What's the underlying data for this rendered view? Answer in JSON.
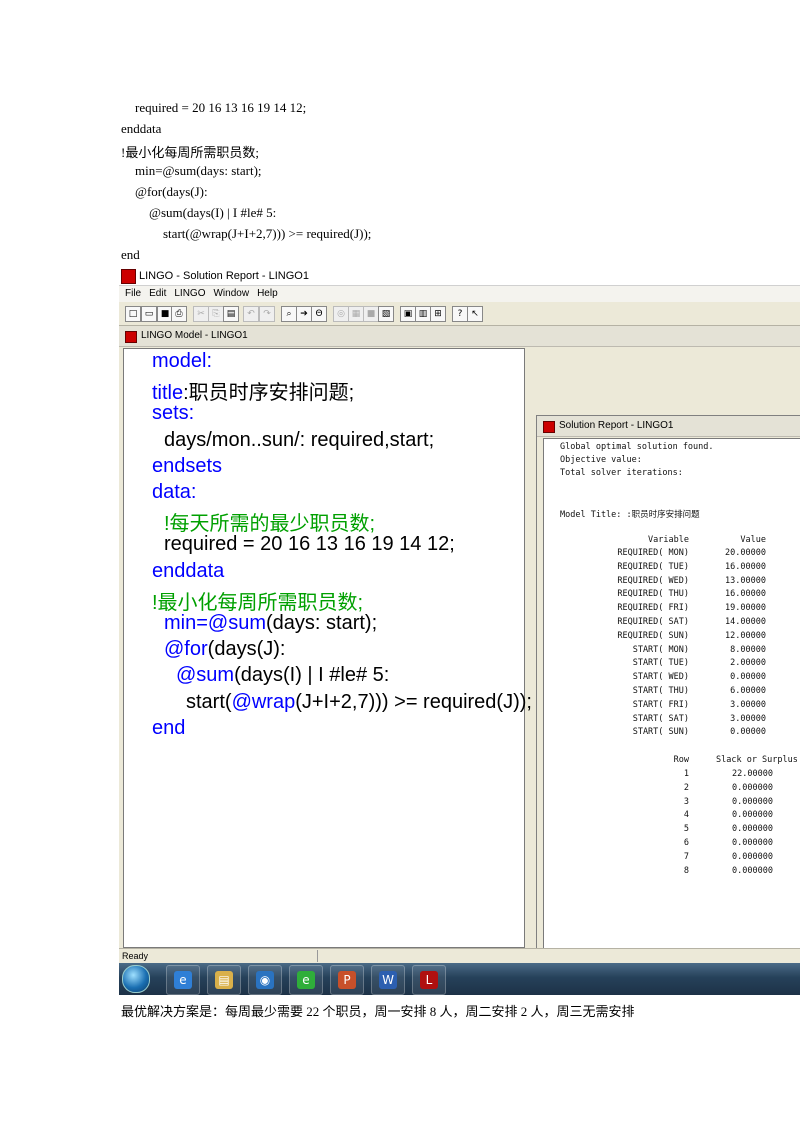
{
  "document_top": [
    "required = 20 16 13 16 19 14 12;",
    "enddata",
    "!最小化每周所需职员数;",
    "min=@sum(days: start);",
    "@for(days(J):",
    "@sum(days(I) | I #le# 5:",
    "start(@wrap(J+I+2,7))) >= required(J));",
    "end"
  ],
  "app": {
    "title": "LINGO - Solution Report - LINGO1",
    "menu": [
      "File",
      "Edit",
      "LINGO",
      "Window",
      "Help"
    ],
    "toolbar_icons": [
      "new-icon",
      "open-icon",
      "save-icon",
      "print-icon",
      "cut-icon",
      "copy-icon",
      "paste-icon",
      "undo-icon",
      "redo-icon",
      "find-icon",
      "goto-icon",
      "match-paren-icon",
      "solve-icon",
      "solution-icon",
      "stop-icon",
      "options-icon",
      "picture-icon",
      "window-icon",
      "tile-icon",
      "help-icon",
      "context-help-icon"
    ],
    "status": "Ready"
  },
  "model_window": {
    "title": "LINGO Model - LINGO1",
    "lines": [
      {
        "text": "model:",
        "style": "kw"
      },
      {
        "text": "title",
        "style": "kw",
        "rest": ":职员时序安排问题;"
      },
      {
        "text": "sets:",
        "style": "kw"
      },
      {
        "text": "",
        "style": "plain",
        "rest": "days/mon..sun/: required,start;"
      },
      {
        "text": "endsets",
        "style": "kw"
      },
      {
        "text": "data:",
        "style": "kw"
      },
      {
        "text": "!每天所需的最少职员数;",
        "style": "cm"
      },
      {
        "text": "",
        "style": "plain",
        "rest": "required = 20 16 13 16 19 14 12;"
      },
      {
        "text": "enddata",
        "style": "kw"
      },
      {
        "text": "!最小化每周所需职员数;",
        "style": "cm"
      },
      {
        "text": "min=",
        "style": "kw",
        "mid": "@sum",
        "rest": "(days: start);"
      },
      {
        "text": "@for",
        "style": "kw",
        "rest": "(days(J):"
      },
      {
        "text": "@sum",
        "style": "kw",
        "rest": "(days(I) | I #le# 5:"
      },
      {
        "text": "",
        "style": "plain",
        "pre": "start(",
        "mid": "@wrap",
        "rest": "(J+I+2,7))) >= required(J));"
      },
      {
        "text": "end",
        "style": "kw"
      }
    ]
  },
  "solution_window": {
    "title": "Solution Report - LINGO1",
    "header": [
      "Global optimal solution found.",
      "Objective value:",
      "Total solver iterations:"
    ],
    "model_title": "Model Title: :职员时序安排问题",
    "var_header": {
      "variable": "Variable",
      "value": "Value"
    },
    "variables": [
      {
        "name": "REQUIRED( MON)",
        "value": "20.00000"
      },
      {
        "name": "REQUIRED( TUE)",
        "value": "16.00000"
      },
      {
        "name": "REQUIRED( WED)",
        "value": "13.00000"
      },
      {
        "name": "REQUIRED( THU)",
        "value": "16.00000"
      },
      {
        "name": "REQUIRED( FRI)",
        "value": "19.00000"
      },
      {
        "name": "REQUIRED( SAT)",
        "value": "14.00000"
      },
      {
        "name": "REQUIRED( SUN)",
        "value": "12.00000"
      },
      {
        "name": "START( MON)",
        "value": "8.00000"
      },
      {
        "name": "START( TUE)",
        "value": "2.00000"
      },
      {
        "name": "START( WED)",
        "value": "0.00000"
      },
      {
        "name": "START( THU)",
        "value": "6.00000"
      },
      {
        "name": "START( FRI)",
        "value": "3.00000"
      },
      {
        "name": "START( SAT)",
        "value": "3.00000"
      },
      {
        "name": "START( SUN)",
        "value": "0.00000"
      }
    ],
    "row_header": {
      "row": "Row",
      "slack": "Slack or Surplus"
    },
    "rows": [
      {
        "row": "1",
        "value": "22.00000"
      },
      {
        "row": "2",
        "value": "0.000000"
      },
      {
        "row": "3",
        "value": "0.000000"
      },
      {
        "row": "4",
        "value": "0.000000"
      },
      {
        "row": "5",
        "value": "0.000000"
      },
      {
        "row": "6",
        "value": "0.000000"
      },
      {
        "row": "7",
        "value": "0.000000"
      },
      {
        "row": "8",
        "value": "0.000000"
      }
    ]
  },
  "taskbar_items": [
    "start-orb-icon",
    "ie-icon",
    "explorer-icon",
    "media-player-icon",
    "browser-icon",
    "powerpoint-icon",
    "word-icon",
    "lingo-icon"
  ],
  "caption": "最优解决方案是：每周最少需要 22 个职员，周一安排 8 人，周二安排 2 人，周三无需安排"
}
